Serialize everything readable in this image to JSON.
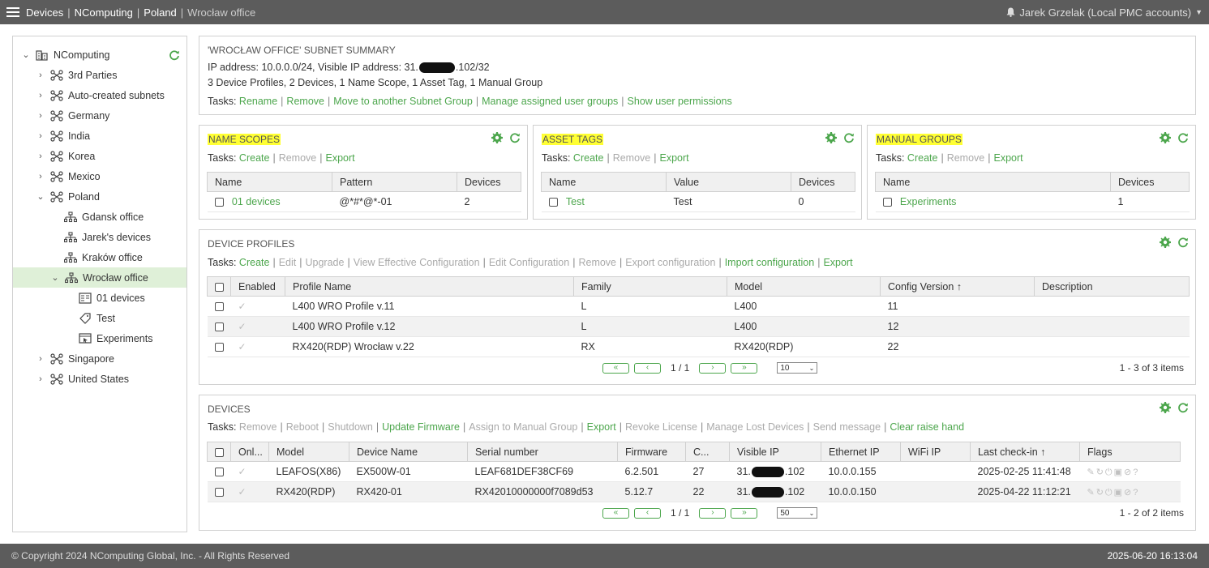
{
  "topbar": {
    "crumbs": [
      "Devices",
      "NComputing",
      "Poland"
    ],
    "current": "Wrocław office",
    "user": "Jarek Grzelak  (Local PMC accounts)"
  },
  "tree": {
    "items": [
      {
        "label": "NComputing"
      },
      {
        "label": "3rd Parties"
      },
      {
        "label": "Auto-created subnets"
      },
      {
        "label": "Germany"
      },
      {
        "label": "India"
      },
      {
        "label": "Korea"
      },
      {
        "label": "Mexico"
      },
      {
        "label": "Poland"
      },
      {
        "label": "Gdansk office"
      },
      {
        "label": "Jarek's devices"
      },
      {
        "label": "Kraków office"
      },
      {
        "label": "Wrocław office"
      },
      {
        "label": "01 devices"
      },
      {
        "label": "Test"
      },
      {
        "label": "Experiments"
      },
      {
        "label": "Singapore"
      },
      {
        "label": "United States"
      }
    ]
  },
  "summary": {
    "title": "'WROCŁAW OFFICE' SUBNET SUMMARY",
    "ip_prefix": "IP address: 10.0.0.0/24, Visible IP address: 31.",
    "ip_suffix": ".102/32",
    "counts": "3 Device Profiles, 2 Devices, 1 Name Scope, 1 Asset Tag, 1 Manual Group",
    "tasks_label": "Tasks:",
    "tasks": [
      "Rename",
      "Remove",
      "Move to another Subnet Group",
      "Manage assigned user groups",
      "Show user permissions"
    ]
  },
  "name_scopes": {
    "title": "NAME SCOPES",
    "tasks_label": "Tasks:",
    "tasks": [
      "Create",
      "Remove",
      "Export"
    ],
    "columns": [
      "Name",
      "Pattern",
      "Devices"
    ],
    "rows": [
      {
        "name": "01 devices",
        "pattern": "@*#*@*-01",
        "devices": "2"
      }
    ]
  },
  "asset_tags": {
    "title": "ASSET TAGS",
    "tasks_label": "Tasks:",
    "tasks": [
      "Create",
      "Remove",
      "Export"
    ],
    "columns": [
      "Name",
      "Value",
      "Devices"
    ],
    "rows": [
      {
        "name": "Test",
        "value": "Test",
        "devices": "0"
      }
    ]
  },
  "manual_groups": {
    "title": "MANUAL GROUPS",
    "tasks_label": "Tasks:",
    "tasks": [
      "Create",
      "Remove",
      "Export"
    ],
    "columns": [
      "Name",
      "Devices"
    ],
    "rows": [
      {
        "name": "Experiments",
        "devices": "1"
      }
    ]
  },
  "device_profiles": {
    "title": "DEVICE PROFILES",
    "tasks_label": "Tasks:",
    "tasks": [
      "Create",
      "Edit",
      "Upgrade",
      "View Effective Configuration",
      "Edit Configuration",
      "Remove",
      "Export configuration",
      "Import configuration",
      "Export"
    ],
    "columns": [
      "Enabled",
      "Profile Name",
      "Family",
      "Model",
      "Config Version ↑",
      "Description"
    ],
    "rows": [
      {
        "name": "L400 WRO Profile v.11",
        "family": "L",
        "model": "L400",
        "version": "11",
        "description": ""
      },
      {
        "name": "L400 WRO Profile v.12",
        "family": "L",
        "model": "L400",
        "version": "12",
        "description": ""
      },
      {
        "name": "RX420(RDP) Wrocław v.22",
        "family": "RX",
        "model": "RX420(RDP)",
        "version": "22",
        "description": ""
      }
    ],
    "page": "1 / 1",
    "page_size": "10",
    "items": "1 - 3 of 3 items"
  },
  "devices": {
    "title": "DEVICES",
    "tasks_label": "Tasks:",
    "tasks": [
      "Remove",
      "Reboot",
      "Shutdown",
      "Update Firmware",
      "Assign to Manual Group",
      "Export",
      "Revoke License",
      "Manage Lost Devices",
      "Send message",
      "Clear raise hand"
    ],
    "columns": [
      "Onl...",
      "Model",
      "Device Name",
      "Serial number",
      "Firmware",
      "C...",
      "Visible IP",
      "Ethernet IP",
      "WiFi IP",
      "Last check-in ↑",
      "Flags"
    ],
    "rows": [
      {
        "model": "LEAFOS(X86)",
        "name": "EX500W-01",
        "serial": "LEAF681DEF38CF69",
        "firmware": "6.2.501",
        "c": "27",
        "ip_prefix": "31.",
        "ip_suffix": ".102",
        "eth": "10.0.0.155",
        "wifi": "",
        "checkin": "2025-02-25 11:41:48"
      },
      {
        "model": "RX420(RDP)",
        "name": "RX420-01",
        "serial": "RX42010000000f7089d53",
        "firmware": "5.12.7",
        "c": "22",
        "ip_prefix": "31.",
        "ip_suffix": ".102",
        "eth": "10.0.0.150",
        "wifi": "",
        "checkin": "2025-04-22 11:12:21"
      }
    ],
    "page": "1 / 1",
    "page_size": "50",
    "items": "1 - 2 of 2 items"
  },
  "footer": {
    "copyright": "© Copyright 2024 NComputing Global, Inc. - All Rights Reserved",
    "clock": "2025-06-20 16:13:04"
  },
  "colors": {
    "accent": "#4ca64c",
    "bar": "#5c5c5c",
    "highlight": "#ffff33",
    "selected": "#dff0d8"
  },
  "icons": [
    "menu-icon",
    "bell-icon",
    "building-icon",
    "network-icon",
    "subnet-icon",
    "name-scope-icon",
    "tag-icon",
    "group-icon",
    "gear-icon",
    "refresh-icon"
  ]
}
